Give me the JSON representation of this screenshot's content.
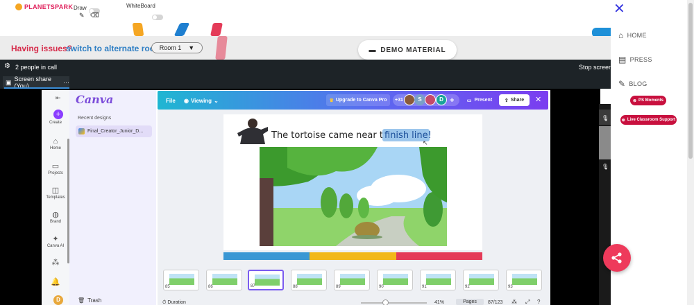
{
  "header": {
    "logo_text": "PLANETSPARK",
    "draw_label": "Draw",
    "whiteboard_label": "WhiteBoard",
    "pencil_icon": "pencil-icon",
    "eraser_icon": "eraser-icon"
  },
  "issue_bar": {
    "issue_text": "Having issues?",
    "switch_text": "switch to alternate room",
    "room_selected": "Room 1",
    "demo_material_label": "DEMO MATERIAL"
  },
  "call_bar": {
    "people_text": "2 people in call",
    "stop_text": "Stop screen",
    "share_tab_label": "Screen share (You)",
    "share_tab_more": "···"
  },
  "canva": {
    "logo": "Canva",
    "nav": [
      {
        "label": "Create",
        "icon": "plus-icon"
      },
      {
        "label": "Home",
        "icon": "home-icon"
      },
      {
        "label": "Projects",
        "icon": "folder-icon"
      },
      {
        "label": "Templates",
        "icon": "templates-icon"
      },
      {
        "label": "Brand",
        "icon": "brand-icon"
      },
      {
        "label": "Canva AI",
        "icon": "sparkle-icon"
      },
      {
        "label": "",
        "icon": "apps-icon"
      },
      {
        "label": "",
        "icon": "bell-icon"
      }
    ],
    "recent_label": "Recent designs",
    "recent_item": "Final_Creator_Junior_D...",
    "trash_label": "Trash",
    "avatar_letter": "D",
    "toolbar": {
      "file": "File",
      "viewing": "Viewing",
      "upgrade": "Upgrade to Canva Pro",
      "collab_count": "+31",
      "avatar_s": "S",
      "avatar_d": "D",
      "present": "Present",
      "share": "Share"
    },
    "slide": {
      "caption_prefix": "The tortoise came near the",
      "caption_highlight": "finish line!",
      "stripe_colors": [
        "#3a97d4",
        "#f2b81a",
        "#e43b58"
      ]
    },
    "thumbnails": [
      {
        "num": "85"
      },
      {
        "num": "86"
      },
      {
        "num": "87",
        "selected": true
      },
      {
        "num": "88"
      },
      {
        "num": "89"
      },
      {
        "num": "90"
      },
      {
        "num": "91"
      },
      {
        "num": "92"
      },
      {
        "num": "93"
      }
    ],
    "bottom": {
      "duration": "Duration",
      "zoom": "41%",
      "pages": "Pages",
      "page_count": "87/123"
    }
  },
  "sidebar": {
    "items": [
      {
        "label": "HOME",
        "icon": "home-icon"
      },
      {
        "label": "PRESS",
        "icon": "newspaper-icon"
      },
      {
        "label": "BLOG",
        "icon": "pencil-icon"
      }
    ],
    "ps_moments": "PS Moments",
    "live_support": "Live Classroom Support",
    "share_fab_icon": "share-icon",
    "close_icon": "close-icon"
  },
  "colors": {
    "brand_red": "#d62b4a",
    "link_blue": "#2f7fc4",
    "canva_purple": "#7c4dda",
    "fab": "#ee3a5b"
  }
}
